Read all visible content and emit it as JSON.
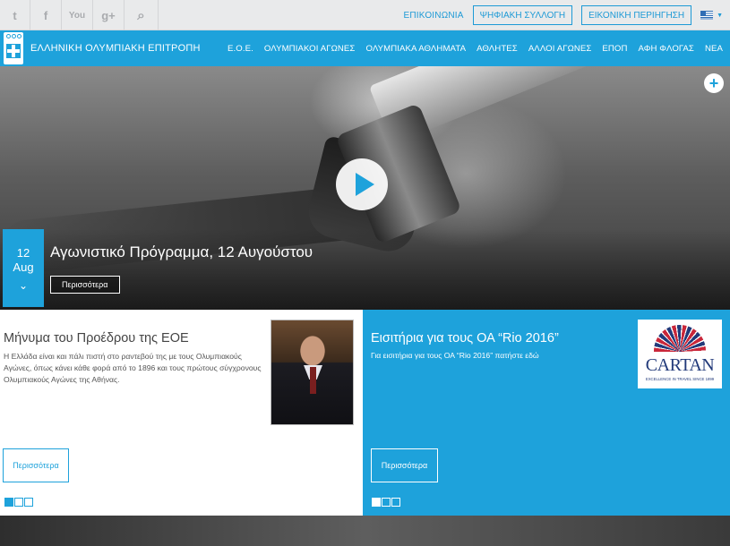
{
  "topbar": {
    "social": [
      {
        "name": "twitter-icon",
        "glyph": "t"
      },
      {
        "name": "facebook-icon",
        "glyph": "f"
      },
      {
        "name": "youtube-icon",
        "glyph": "You"
      },
      {
        "name": "google-plus-icon",
        "glyph": "g+"
      },
      {
        "name": "search-icon",
        "glyph": "⌕"
      }
    ],
    "contact_label": "ΕΠΙΚΟΙΝΩΝΙΑ",
    "digital_collection_label": "ΨΗΦΙΑΚΗ ΣΥΛΛΟΓΗ",
    "virtual_tour_label": "ΕΙΚΟΝΙΚΗ ΠΕΡΙΗΓΗΣΗ",
    "language_caret": "▼"
  },
  "nav": {
    "brand_name": "ΕΛΛΗΝΙΚΗ ΟΛΥΜΠΙΑΚΗ ΕΠΙΤΡΟΠΗ",
    "items": [
      "Ε.Ο.Ε.",
      "ΟΛΥΜΠΙΑΚΟΙ ΑΓΩΝΕΣ",
      "ΟΛΥΜΠΙΑΚΑ ΑΘΛΗΜΑΤΑ",
      "ΑΘΛΗΤΕΣ",
      "ΑΛΛΟΙ ΑΓΩΝΕΣ",
      "ΕΠΟΠ",
      "ΑΦΗ ΦΛΟΓΑΣ",
      "ΝΕΑ"
    ]
  },
  "hero": {
    "plus_glyph": "+",
    "date_day": "12",
    "date_month": "Aug",
    "date_chevron": "⌄",
    "title": "Αγωνιστικό Πρόγραμμα, 12 Αυγούστου",
    "more_label": "Περισσότερα"
  },
  "president": {
    "title": "Μήνυμα του Προέδρου της ΕΟΕ",
    "text": "Η Ελλάδα είναι και πάλι πιστή στο ραντεβού της με τους Ολυμπιακούς Αγώνες, όπως κάνει κάθε φορά από το 1896 και τους πρώτους σύγχρονους Ολυμπιακούς Αγώνες της Αθήνας.",
    "more_label": "Περισσότερα",
    "slides": 3,
    "active_slide": 1
  },
  "tickets": {
    "title": "Εισιτήρια για τους ΟΑ “Rio 2016”",
    "text": "Για εισιτήρια για τους ΟΑ “Rio 2016” πατήστε εδώ",
    "logo_word": "CARTAN",
    "logo_tagline": "EXCELLENCE IN TRAVEL SINCE 1899",
    "more_label": "Περισσότερα",
    "slides": 3,
    "active_slide": 1
  },
  "colors": {
    "accent": "#1ea2db",
    "topbar_bg": "#e9eaeb"
  }
}
